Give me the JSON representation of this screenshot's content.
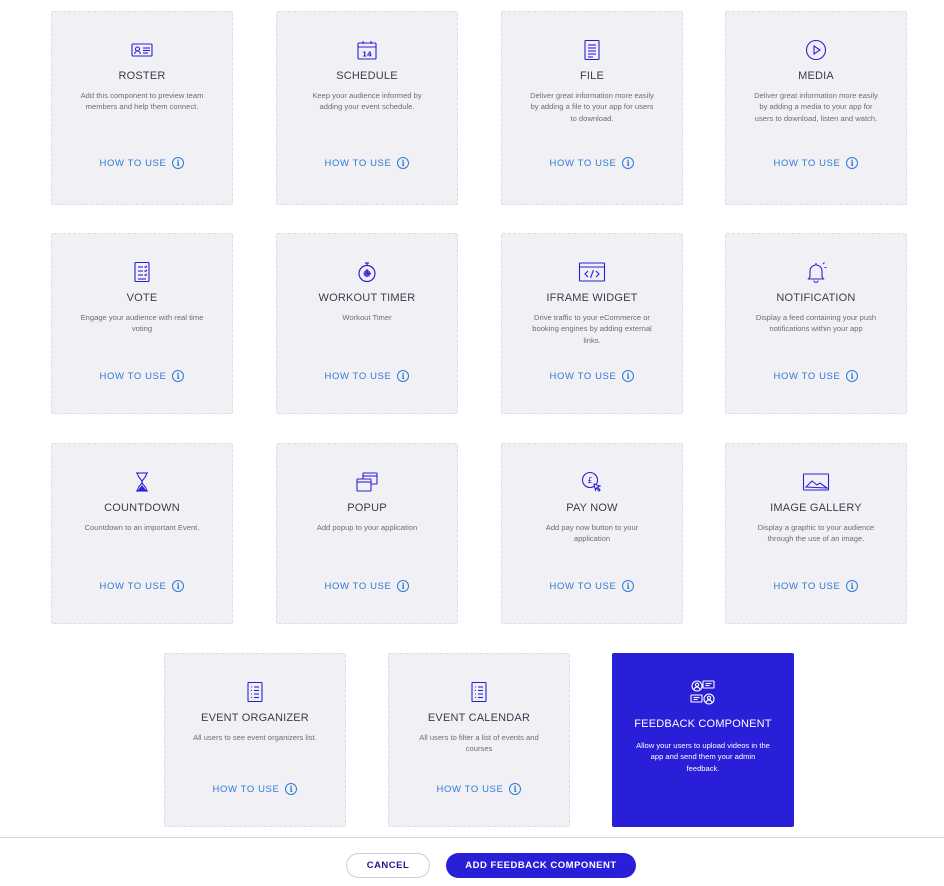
{
  "how_to_label": "HOW TO USE",
  "colors": {
    "accent": "#2a1fd8",
    "link": "#2d7bd4",
    "card_bg": "#f1f1f5"
  },
  "cards": [
    {
      "title": "ROSTER",
      "icon": "roster-icon",
      "description": "Add this component to preview team members and help them connect."
    },
    {
      "title": "SCHEDULE",
      "icon": "calendar-icon",
      "description": "Keep your audience informed by adding your event schedule."
    },
    {
      "title": "FILE",
      "icon": "file-icon",
      "description": "Deliver great information more easily by adding a file to your app for users to download."
    },
    {
      "title": "MEDIA",
      "icon": "play-icon",
      "description": "Deliver great information more easily by adding a media to your app for users to download, listen and watch."
    },
    {
      "title": "VOTE",
      "icon": "vote-icon",
      "description": "Engage your audience with real time voting"
    },
    {
      "title": "WORKOUT TIMER",
      "icon": "stopwatch-icon",
      "description": "Workout Timer"
    },
    {
      "title": "IFRAME WIDGET",
      "icon": "code-icon",
      "description": "Drive traffic to your eCommerce or booking engines by adding external links."
    },
    {
      "title": "NOTIFICATION",
      "icon": "bell-icon",
      "description": "Display a feed containing your push notifications within your app"
    },
    {
      "title": "COUNTDOWN",
      "icon": "hourglass-icon",
      "description": "Countdown to an important Event."
    },
    {
      "title": "POPUP",
      "icon": "popup-icon",
      "description": "Add popup to your application"
    },
    {
      "title": "PAY NOW",
      "icon": "pay-icon",
      "description": "Add pay now button to your application"
    },
    {
      "title": "IMAGE GALLERY",
      "icon": "image-icon",
      "description": "Display a graphic to your audience through the use of an image."
    },
    {
      "title": "EVENT ORGANIZER",
      "icon": "list-icon",
      "description": "All users to see event organizers list."
    },
    {
      "title": "EVENT CALENDAR",
      "icon": "list-icon",
      "description": "All users to filter a list of events and courses"
    },
    {
      "title": "FEEDBACK COMPONENT",
      "icon": "feedback-icon",
      "description": "Allow your users to upload videos in the app and send them your admin feedback."
    }
  ],
  "footer": {
    "cancel_label": "CANCEL",
    "add_label": "ADD FEEDBACK COMPONENT"
  }
}
